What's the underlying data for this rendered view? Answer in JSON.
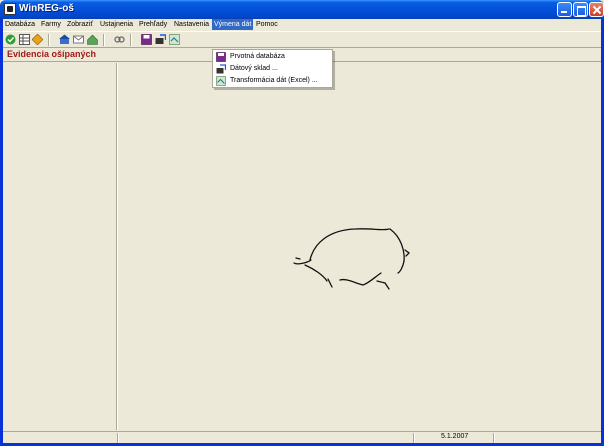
{
  "window": {
    "title": "WinREG-oš"
  },
  "menu": {
    "items": [
      "Databáza",
      "Farmy",
      "Zobraziť",
      "Ustajnenia",
      "Prehľady",
      "Nastavenia",
      "Výmena dát",
      "Pomoc"
    ],
    "active": "Výmena dát"
  },
  "dropdown": {
    "items": [
      {
        "label": "Prvotná databáza",
        "icon": "database-icon"
      },
      {
        "label": "Dátový sklad ...",
        "icon": "data-warehouse-icon"
      },
      {
        "label": "Transformácia dát (Excel) ...",
        "icon": "excel-transform-icon"
      }
    ]
  },
  "toolbar": {
    "icons": [
      "confirm-icon",
      "table-icon",
      "arrows-icon",
      "farm-icon",
      "mail-icon",
      "building-icon",
      "link-icon",
      "save-icon",
      "export-icon",
      "import-icon"
    ]
  },
  "panel": {
    "title": "Evidencia ošípaných"
  },
  "status": {
    "date": "5.1.2007"
  },
  "colors": {
    "title_bar": "#0251d8",
    "menu_highlight": "#316ac5",
    "panel_title": "#a11b1b",
    "background": "#ece9d8"
  }
}
